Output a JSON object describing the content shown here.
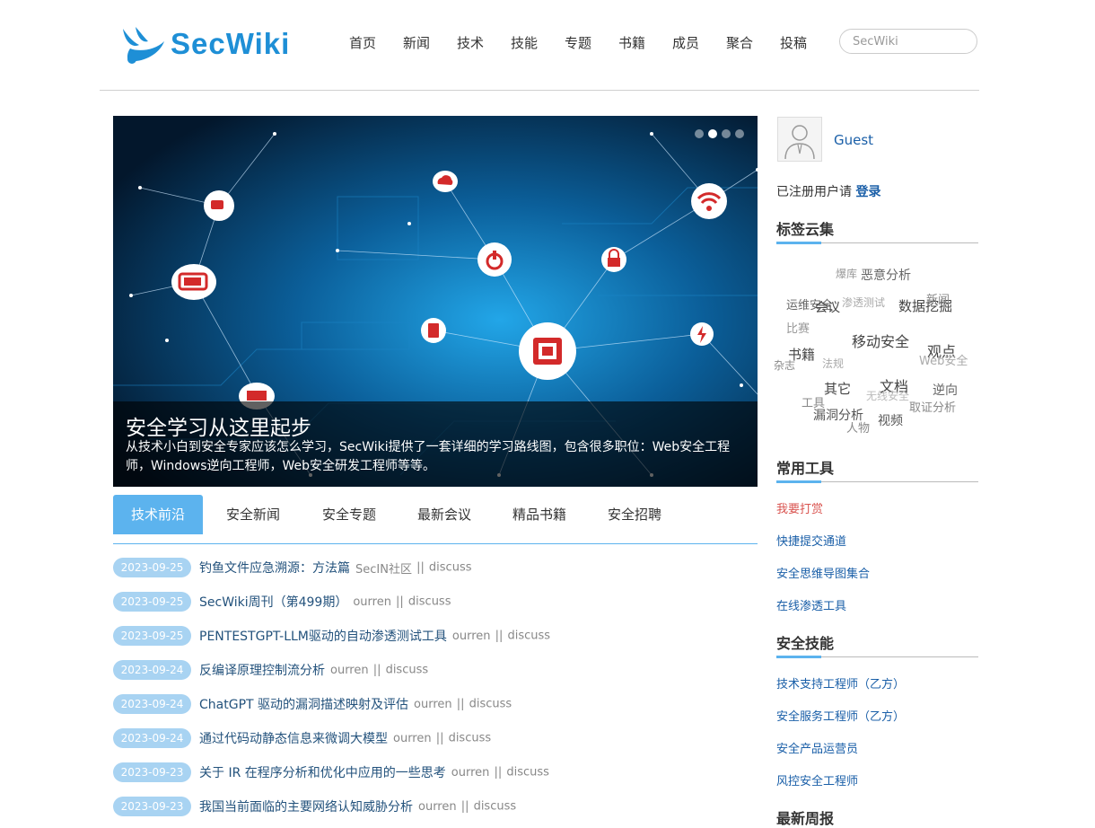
{
  "header": {
    "logo_text": "SecWiki",
    "nav": [
      "首页",
      "新闻",
      "技术",
      "技能",
      "专题",
      "书籍",
      "成员",
      "聚合",
      "投稿"
    ],
    "search_placeholder": "SecWiki"
  },
  "banner": {
    "title": "安全学习从这里起步",
    "description": "从技术小白到安全专家应该怎么学习，SecWiki提供了一套详细的学习路线图，包含很多职位：Web安全工程师，Windows逆向工程师，Web安全研发工程师等等。",
    "slides_total": 4,
    "active_slide": 2
  },
  "tabs": [
    "技术前沿",
    "安全新闻",
    "安全专题",
    "最新会议",
    "精品书籍",
    "安全招聘"
  ],
  "active_tab": 0,
  "news": [
    {
      "date": "2023-09-25",
      "title": "钓鱼文件应急溯源：方法篇",
      "source": "SecIN社区",
      "sep": "||",
      "link": "discuss"
    },
    {
      "date": "2023-09-25",
      "title": "SecWiki周刊（第499期）",
      "source": "ourren",
      "sep": "||",
      "link": "discuss"
    },
    {
      "date": "2023-09-25",
      "title": "PENTESTGPT-LLM驱动的自动渗透测试工具",
      "source": "ourren",
      "sep": "||",
      "link": "discuss"
    },
    {
      "date": "2023-09-24",
      "title": "反编译原理控制流分析",
      "source": "ourren",
      "sep": "||",
      "link": "discuss"
    },
    {
      "date": "2023-09-24",
      "title": "ChatGPT 驱动的漏洞描述映射及评估",
      "source": "ourren",
      "sep": "||",
      "link": "discuss"
    },
    {
      "date": "2023-09-24",
      "title": "通过代码动静态信息来微调大模型",
      "source": "ourren",
      "sep": "||",
      "link": "discuss"
    },
    {
      "date": "2023-09-23",
      "title": "关于 IR 在程序分析和优化中应用的一些思考",
      "source": "ourren",
      "sep": "||",
      "link": "discuss"
    },
    {
      "date": "2023-09-23",
      "title": "我国当前面临的主要网络认知威胁分析",
      "source": "ourren",
      "sep": "||",
      "link": "discuss"
    }
  ],
  "sidebar": {
    "user_name": "Guest",
    "register_text": "已注册用户请",
    "login_label": "登录",
    "tag_cloud_title": "标签云集",
    "tags": [
      {
        "text": "爆库",
        "size": 12,
        "color": "#999999"
      },
      {
        "text": "恶意分析",
        "size": 14,
        "color": "#666666"
      },
      {
        "text": "运维安全",
        "size": 13,
        "color": "#666666"
      },
      {
        "text": "会议",
        "size": 14,
        "color": "#444444"
      },
      {
        "text": "渗透测试",
        "size": 12,
        "color": "#aaaaaa"
      },
      {
        "text": "数据挖掘",
        "size": 15,
        "color": "#444444"
      },
      {
        "text": "新闻",
        "size": 13,
        "color": "#888888"
      },
      {
        "text": "比赛",
        "size": 13,
        "color": "#999999"
      },
      {
        "text": "移动安全",
        "size": 16,
        "color": "#444444"
      },
      {
        "text": "书籍",
        "size": 15,
        "color": "#444444"
      },
      {
        "text": "观点",
        "size": 16,
        "color": "#444444"
      },
      {
        "text": "杂志",
        "size": 12,
        "color": "#888888"
      },
      {
        "text": "法规",
        "size": 12,
        "color": "#aaaaaa"
      },
      {
        "text": "Web安全",
        "size": 13,
        "color": "#aaaaaa"
      },
      {
        "text": "文档",
        "size": 16,
        "color": "#444444"
      },
      {
        "text": "其它",
        "size": 15,
        "color": "#444444"
      },
      {
        "text": "逆向",
        "size": 14,
        "color": "#666666"
      },
      {
        "text": "工具",
        "size": 13,
        "color": "#888888"
      },
      {
        "text": "无线安全",
        "size": 12,
        "color": "#bbbbbb"
      },
      {
        "text": "取证分析",
        "size": 13,
        "color": "#888888"
      },
      {
        "text": "漏洞分析",
        "size": 14,
        "color": "#555555"
      },
      {
        "text": "人物",
        "size": 13,
        "color": "#888888"
      },
      {
        "text": "视频",
        "size": 14,
        "color": "#555555"
      }
    ],
    "tools_title": "常用工具",
    "tools": [
      {
        "label": "我要打赏",
        "color": "#d9534f"
      },
      {
        "label": "快捷提交通道",
        "color": "#1a5fa8"
      },
      {
        "label": "安全思维导图集合",
        "color": "#1a5fa8"
      },
      {
        "label": "在线渗透工具",
        "color": "#1a5fa8"
      }
    ],
    "skills_title": "安全技能",
    "skills": [
      "技术支持工程师（乙方）",
      "安全服务工程师（乙方）",
      "安全产品运营员",
      "风控安全工程师"
    ],
    "weekly_title": "最新周报"
  }
}
